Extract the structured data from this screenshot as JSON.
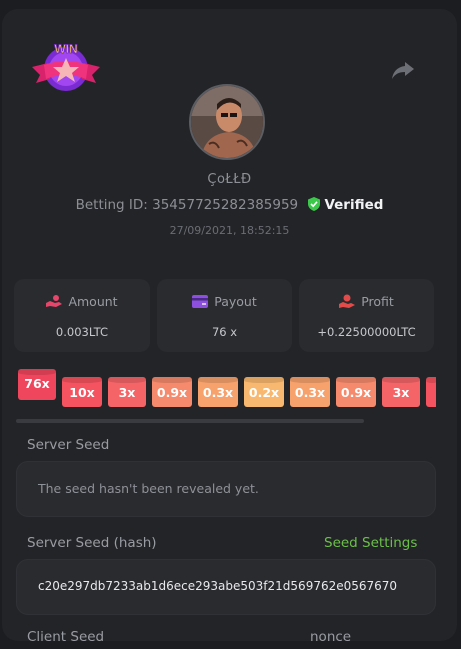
{
  "user": {
    "name": "ÇoŁŁĐ",
    "betting_id_label": "Betting ID:",
    "betting_id": "354577252823859 59",
    "verified_label": "Verified",
    "date": "27/09/2021, 18:52:15",
    "badge_text": "WIN"
  },
  "stats": [
    {
      "label": "Amount",
      "value": "0.003LTC",
      "icon": "hand-coins-icon",
      "color": "#e8456a"
    },
    {
      "label": "Payout",
      "value": "76 x",
      "icon": "wallet-card-icon",
      "color": "#8d4fe0"
    },
    {
      "label": "Profit",
      "value": "+0.22500000LTC",
      "icon": "hand-money-icon",
      "color": "#e34b4b"
    }
  ],
  "multipliers": [
    {
      "label": "76x",
      "color": "#f0465d"
    },
    {
      "label": "10x",
      "color": "#f5535f"
    },
    {
      "label": "3x",
      "color": "#f56568"
    },
    {
      "label": "0.9x",
      "color": "#f58a6c"
    },
    {
      "label": "0.3x",
      "color": "#f7a26d"
    },
    {
      "label": "0.2x",
      "color": "#f9b86f"
    },
    {
      "label": "0.3x",
      "color": "#f7a26d"
    },
    {
      "label": "0.9x",
      "color": "#f58a6c"
    },
    {
      "label": "3x",
      "color": "#f56568"
    }
  ],
  "server_seed": {
    "label": "Server Seed",
    "value": "The seed hasn't been revealed yet."
  },
  "server_hash": {
    "label": "Server Seed (hash)",
    "settings_link": "Seed Settings",
    "value": "c20e297db7233ab1d6ece293abe503f21d569762e0567670"
  },
  "client": {
    "label": "Client Seed",
    "nonce_label": "nonce"
  },
  "colors": {
    "accent_green": "#6cc04a",
    "verified_green": "#3cc84a",
    "panel": "#232427"
  }
}
